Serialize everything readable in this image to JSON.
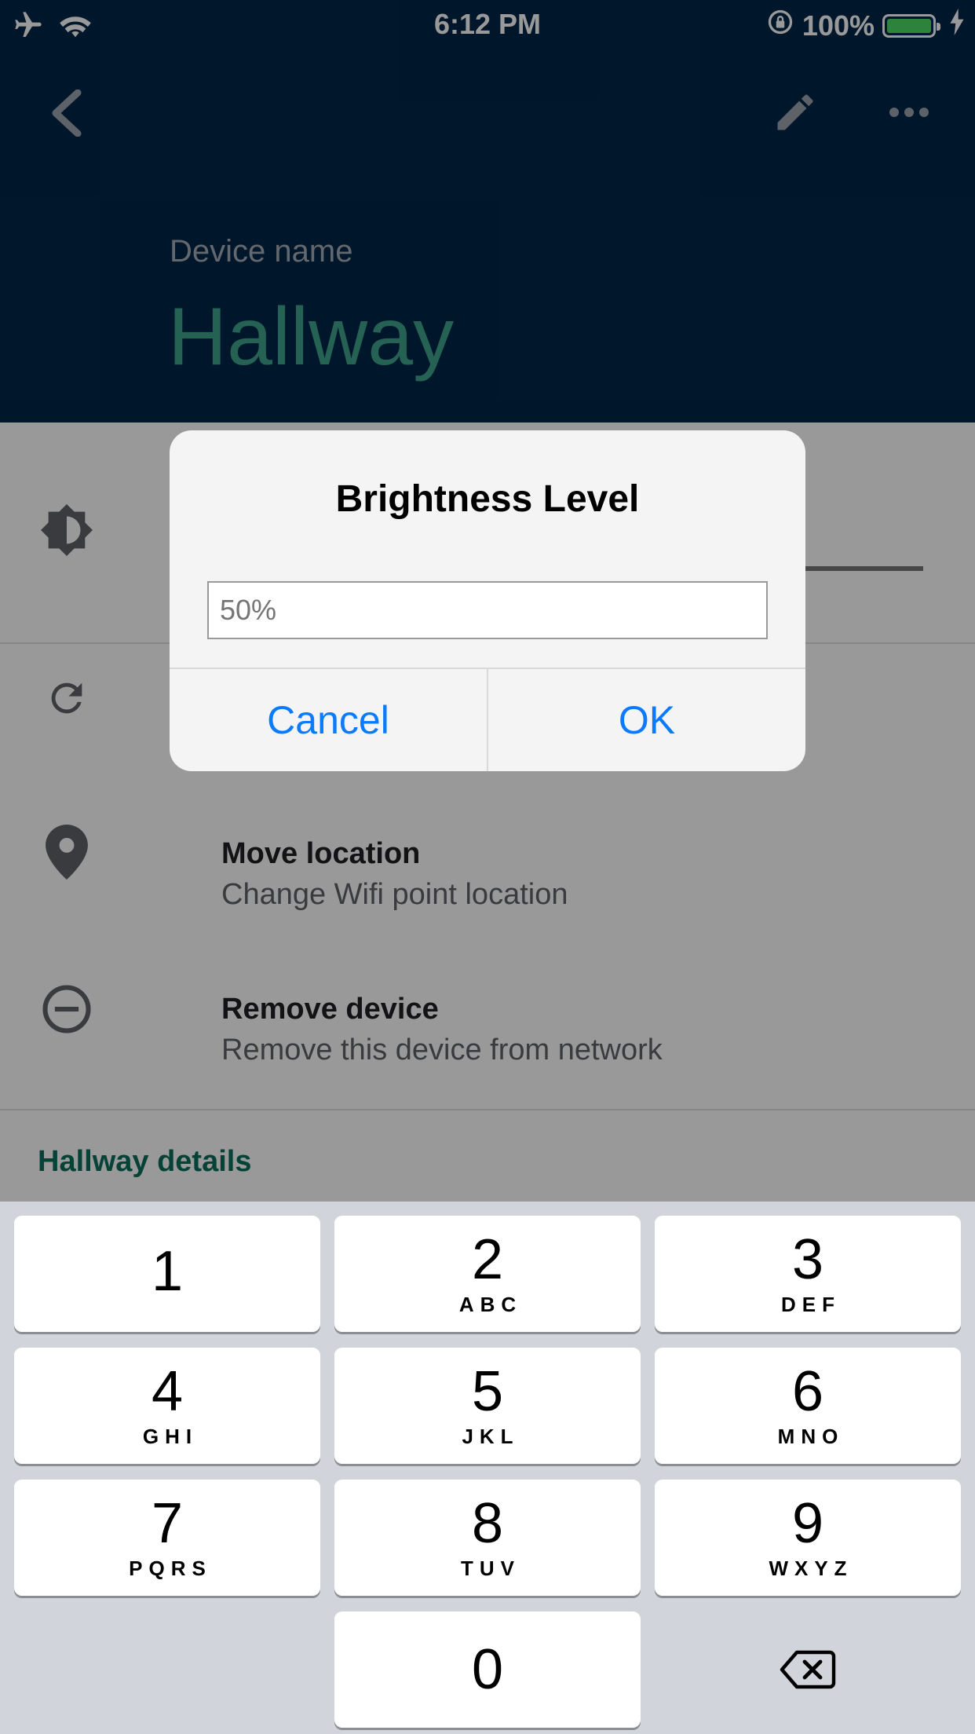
{
  "status_bar": {
    "time": "6:12 PM",
    "battery": "100%"
  },
  "header": {
    "device_label": "Device name",
    "device_name": "Hallway"
  },
  "rows": [
    {
      "title": "Move location",
      "subtitle": "Change Wifi point location"
    },
    {
      "title": "Remove device",
      "subtitle": "Remove this device from network"
    }
  ],
  "section_title": "Hallway details",
  "dialog": {
    "title": "Brightness Level",
    "placeholder": "50%",
    "cancel": "Cancel",
    "ok": "OK"
  },
  "keypad": {
    "keys": [
      {
        "num": "1",
        "letters": ""
      },
      {
        "num": "2",
        "letters": "ABC"
      },
      {
        "num": "3",
        "letters": "DEF"
      },
      {
        "num": "4",
        "letters": "GHI"
      },
      {
        "num": "5",
        "letters": "JKL"
      },
      {
        "num": "6",
        "letters": "MNO"
      },
      {
        "num": "7",
        "letters": "PQRS"
      },
      {
        "num": "8",
        "letters": "TUV"
      },
      {
        "num": "9",
        "letters": "WXYZ"
      },
      {
        "num": "0",
        "letters": ""
      }
    ]
  },
  "icons": [
    "airplane-icon",
    "wifi-icon",
    "rotation-lock-icon",
    "battery-icon",
    "charging-icon",
    "back-arrow-icon",
    "edit-icon",
    "more-icon",
    "brightness-icon",
    "refresh-icon",
    "location-pin-icon",
    "remove-icon",
    "backspace-icon"
  ],
  "colors": {
    "header_bg": "#012749",
    "accent_teal": "#3fa38a",
    "section_teal": "#0c6f5d",
    "ios_blue": "#0a7aff",
    "keypad_bg": "#d1d4da"
  }
}
